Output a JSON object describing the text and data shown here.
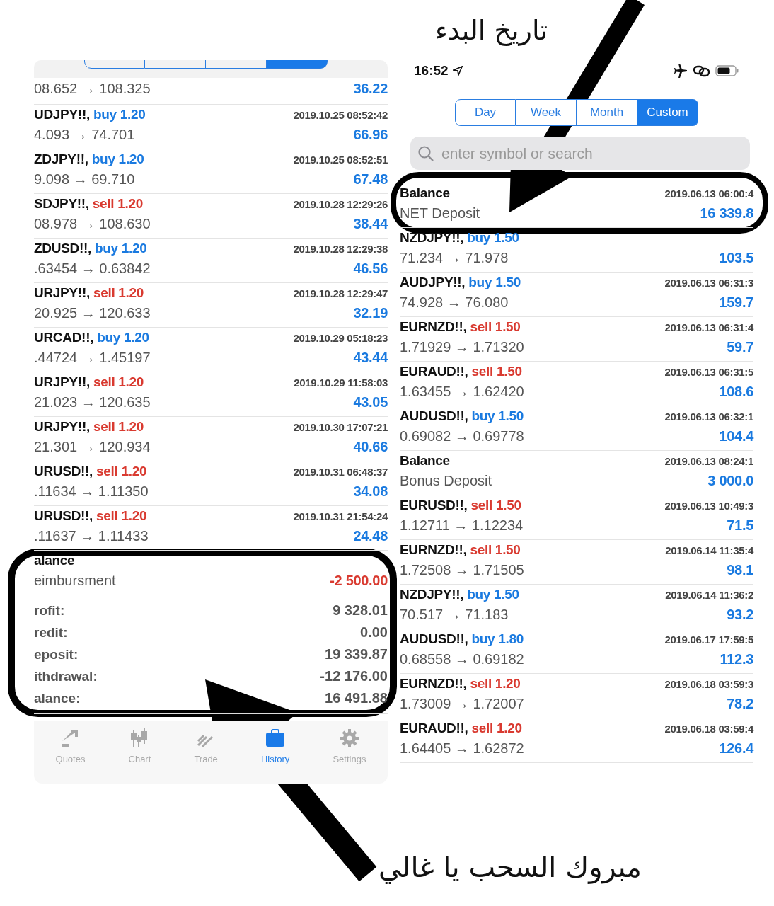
{
  "captions": {
    "top": "تاريخ البدء",
    "bottom": "مبروك السحب يا غالي"
  },
  "left": {
    "period_tabs": [
      {
        "selected": false
      },
      {
        "selected": false
      },
      {
        "selected": false
      },
      {
        "selected": true
      }
    ],
    "rows": [
      {
        "kind": "trade",
        "prices": "08.652 → 108.325",
        "profit": "36.22",
        "loss": false
      },
      {
        "kind": "trade",
        "symbol": "UDJPY!!,",
        "side": "buy 1.20",
        "sell": false,
        "time": "2019.10.25 08:52:42",
        "prices": "4.093 → 74.701",
        "profit": "66.96",
        "loss": false
      },
      {
        "kind": "trade",
        "symbol": "ZDJPY!!,",
        "side": "buy 1.20",
        "sell": false,
        "time": "2019.10.25 08:52:51",
        "prices": "9.098 → 69.710",
        "profit": "67.48",
        "loss": false
      },
      {
        "kind": "trade",
        "symbol": "SDJPY!!,",
        "side": "sell 1.20",
        "sell": true,
        "time": "2019.10.28 12:29:26",
        "prices": "08.978 → 108.630",
        "profit": "38.44",
        "loss": false
      },
      {
        "kind": "trade",
        "symbol": "ZDUSD!!,",
        "side": "buy 1.20",
        "sell": false,
        "time": "2019.10.28 12:29:38",
        "prices": ".63454 → 0.63842",
        "profit": "46.56",
        "loss": false
      },
      {
        "kind": "trade",
        "symbol": "URJPY!!,",
        "side": "sell 1.20",
        "sell": true,
        "time": "2019.10.28 12:29:47",
        "prices": "20.925 → 120.633",
        "profit": "32.19",
        "loss": false
      },
      {
        "kind": "trade",
        "symbol": "URCAD!!,",
        "side": "buy 1.20",
        "sell": false,
        "time": "2019.10.29 05:18:23",
        "prices": ".44724 → 1.45197",
        "profit": "43.44",
        "loss": false
      },
      {
        "kind": "trade",
        "symbol": "URJPY!!,",
        "side": "sell 1.20",
        "sell": true,
        "time": "2019.10.29 11:58:03",
        "prices": "21.023 → 120.635",
        "profit": "43.05",
        "loss": false
      },
      {
        "kind": "trade",
        "symbol": "URJPY!!,",
        "side": "sell 1.20",
        "sell": true,
        "time": "2019.10.30 17:07:21",
        "prices": "21.301 → 120.934",
        "profit": "40.66",
        "loss": false
      },
      {
        "kind": "trade",
        "symbol": "URUSD!!,",
        "side": "sell 1.20",
        "sell": true,
        "time": "2019.10.31 06:48:37",
        "prices": ".11634 → 1.11350",
        "profit": "34.08",
        "loss": false
      },
      {
        "kind": "trade",
        "symbol": "URUSD!!,",
        "side": "sell 1.20",
        "sell": true,
        "time": "2019.10.31 21:54:24",
        "prices": ".11637 → 1.11433",
        "profit": "24.48",
        "loss": false
      },
      {
        "kind": "balance",
        "title": "alance",
        "comment": "eimbursment",
        "profit": "-2 500.00",
        "loss": true
      }
    ],
    "summary": [
      {
        "label": "rofit:",
        "value": "9 328.01"
      },
      {
        "label": "redit:",
        "value": "0.00"
      },
      {
        "label": "eposit:",
        "value": "19 339.87"
      },
      {
        "label": "ithdrawal:",
        "value": "-12 176.00"
      },
      {
        "label": "alance:",
        "value": "16 491.88"
      }
    ],
    "tabbar": [
      {
        "label": "Quotes",
        "kind": "quotes",
        "selected": false
      },
      {
        "label": "Chart",
        "kind": "chart",
        "selected": false
      },
      {
        "label": "Trade",
        "kind": "trade",
        "selected": false
      },
      {
        "label": "History",
        "kind": "history",
        "selected": true
      },
      {
        "label": "Settings",
        "kind": "settings",
        "selected": false
      }
    ]
  },
  "right": {
    "status_bar": {
      "time": "16:52"
    },
    "period_tabs": [
      {
        "label": "Day",
        "selected": false
      },
      {
        "label": "Week",
        "selected": false
      },
      {
        "label": "Month",
        "selected": false
      },
      {
        "label": "Custom",
        "selected": true
      }
    ],
    "search": {
      "placeholder": "enter symbol or search"
    },
    "rows": [
      {
        "kind": "balance",
        "title": "Balance",
        "time": "2019.06.13 06:00:4",
        "comment": "NET Deposit",
        "profit": "16 339.8",
        "loss": false
      },
      {
        "kind": "trade",
        "symbol": "NZDJPY!!,",
        "side": "buy 1.50",
        "sell": false,
        "prices": "71.234 → 71.978",
        "profit": "103.5",
        "loss": false
      },
      {
        "kind": "trade",
        "symbol": "AUDJPY!!,",
        "side": "buy 1.50",
        "sell": false,
        "time": "2019.06.13 06:31:3",
        "prices": "74.928 → 76.080",
        "profit": "159.7",
        "loss": false
      },
      {
        "kind": "trade",
        "symbol": "EURNZD!!,",
        "side": "sell 1.50",
        "sell": true,
        "time": "2019.06.13 06:31:4",
        "prices": "1.71929 → 1.71320",
        "profit": "59.7",
        "loss": false
      },
      {
        "kind": "trade",
        "symbol": "EURAUD!!,",
        "side": "sell 1.50",
        "sell": true,
        "time": "2019.06.13 06:31:5",
        "prices": "1.63455 → 1.62420",
        "profit": "108.6",
        "loss": false
      },
      {
        "kind": "trade",
        "symbol": "AUDUSD!!,",
        "side": "buy 1.50",
        "sell": false,
        "time": "2019.06.13 06:32:1",
        "prices": "0.69082 → 0.69778",
        "profit": "104.4",
        "loss": false
      },
      {
        "kind": "balance",
        "title": "Balance",
        "time": "2019.06.13 08:24:1",
        "comment": "Bonus Deposit",
        "profit": "3 000.0",
        "loss": false
      },
      {
        "kind": "trade",
        "symbol": "EURUSD!!,",
        "side": "sell 1.50",
        "sell": true,
        "time": "2019.06.13 10:49:3",
        "prices": "1.12711 → 1.12234",
        "profit": "71.5",
        "loss": false
      },
      {
        "kind": "trade",
        "symbol": "EURNZD!!,",
        "side": "sell 1.50",
        "sell": true,
        "time": "2019.06.14 11:35:4",
        "prices": "1.72508 → 1.71505",
        "profit": "98.1",
        "loss": false
      },
      {
        "kind": "trade",
        "symbol": "NZDJPY!!,",
        "side": "buy 1.50",
        "sell": false,
        "time": "2019.06.14 11:36:2",
        "prices": "70.517 → 71.183",
        "profit": "93.2",
        "loss": false
      },
      {
        "kind": "trade",
        "symbol": "AUDUSD!!,",
        "side": "buy 1.80",
        "sell": false,
        "time": "2019.06.17 17:59:5",
        "prices": "0.68558 → 0.69182",
        "profit": "112.3",
        "loss": false
      },
      {
        "kind": "trade",
        "symbol": "EURNZD!!,",
        "side": "sell 1.20",
        "sell": true,
        "time": "2019.06.18 03:59:3",
        "prices": "1.73009 → 1.72007",
        "profit": "78.2",
        "loss": false
      },
      {
        "kind": "trade",
        "symbol": "EURAUD!!,",
        "side": "sell 1.20",
        "sell": true,
        "time": "2019.06.18 03:59:4",
        "prices": "1.64405 → 1.62872",
        "profit": "126.4",
        "loss": false
      }
    ]
  }
}
